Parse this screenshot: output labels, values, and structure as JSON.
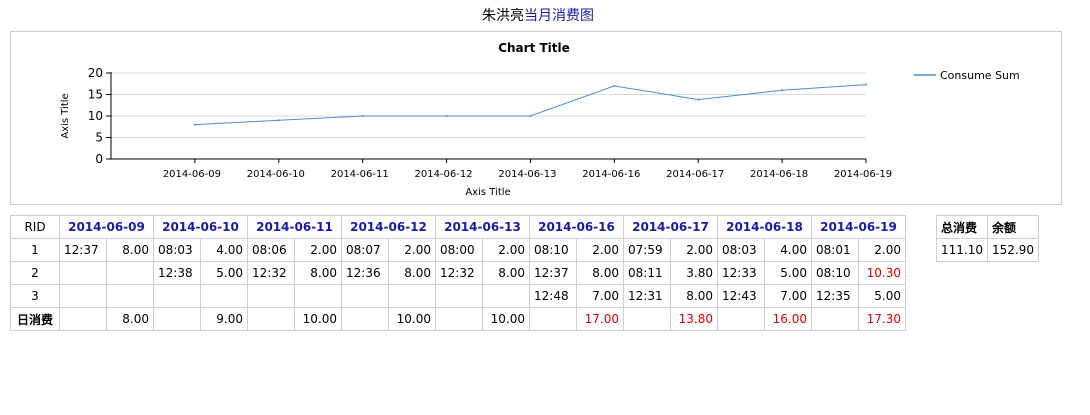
{
  "page_title": {
    "name": "朱洪亮",
    "link": "当月消费图"
  },
  "chart_data": {
    "type": "line",
    "title": "Chart Title",
    "xlabel": "Axis Title",
    "ylabel": "Axis Title",
    "categories": [
      "2014-06-09",
      "2014-06-10",
      "2014-06-11",
      "2014-06-12",
      "2014-06-13",
      "2014-06-16",
      "2014-06-17",
      "2014-06-18",
      "2014-06-19"
    ],
    "series": [
      {
        "name": "Consume Sum",
        "values": [
          8.0,
          9.0,
          10.0,
          10.0,
          10.0,
          17.0,
          13.8,
          16.0,
          17.3
        ],
        "color": "#4a8fd4"
      }
    ],
    "ylim": [
      0,
      20
    ],
    "yticks": [
      "0",
      "5",
      "10",
      "15",
      "20"
    ],
    "grid": true,
    "legend": "right"
  },
  "table": {
    "rid_header": "RID",
    "dates": [
      "2014-06-09",
      "2014-06-10",
      "2014-06-11",
      "2014-06-12",
      "2014-06-13",
      "2014-06-16",
      "2014-06-17",
      "2014-06-18",
      "2014-06-19"
    ],
    "rows": [
      {
        "rid": "1",
        "cells": [
          [
            "12:37",
            "8.00"
          ],
          [
            "08:03",
            "4.00"
          ],
          [
            "08:06",
            "2.00"
          ],
          [
            "08:07",
            "2.00"
          ],
          [
            "08:00",
            "2.00"
          ],
          [
            "08:10",
            "2.00"
          ],
          [
            "07:59",
            "2.00"
          ],
          [
            "08:03",
            "4.00"
          ],
          [
            "08:01",
            "2.00"
          ]
        ]
      },
      {
        "rid": "2",
        "cells": [
          [
            "",
            ""
          ],
          [
            "12:38",
            "5.00"
          ],
          [
            "12:32",
            "8.00"
          ],
          [
            "12:36",
            "8.00"
          ],
          [
            "12:32",
            "8.00"
          ],
          [
            "12:37",
            "8.00"
          ],
          [
            "08:11",
            "3.80"
          ],
          [
            "12:33",
            "5.00"
          ],
          [
            "08:10",
            "10.30"
          ]
        ]
      },
      {
        "rid": "3",
        "cells": [
          [
            "",
            ""
          ],
          [
            "",
            ""
          ],
          [
            "",
            ""
          ],
          [
            "",
            ""
          ],
          [
            "",
            ""
          ],
          [
            "12:48",
            "7.00"
          ],
          [
            "12:31",
            "8.00"
          ],
          [
            "12:43",
            "7.00"
          ],
          [
            "12:35",
            "5.00"
          ]
        ]
      }
    ],
    "daily_label": "日消费",
    "daily": [
      "8.00",
      "9.00",
      "10.00",
      "10.00",
      "10.00",
      "17.00",
      "13.80",
      "16.00",
      "17.30"
    ],
    "red_cells": [
      [
        1,
        8
      ]
    ],
    "red_daily": [
      5,
      6,
      7,
      8
    ],
    "red_color": "#e00000"
  },
  "summary": {
    "total_label": "总消费",
    "balance_label": "余额",
    "total": "111.10",
    "balance": "152.90"
  }
}
